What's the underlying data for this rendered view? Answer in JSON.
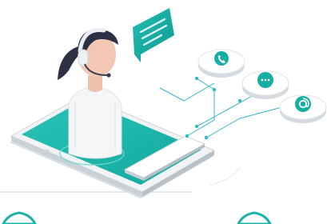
{
  "scene": {
    "channels": [
      {
        "name": "phone",
        "icon": "phone-icon"
      },
      {
        "name": "chat",
        "icon": "chat-bubble-icon"
      },
      {
        "name": "email",
        "icon": "at-sign-icon"
      }
    ],
    "colors": {
      "teal": "#1bb3a8",
      "teal_dark": "#0f8f87",
      "skin": "#f2c7b3",
      "hair": "#2d2f45",
      "shirt": "#f4f6f8",
      "headset": "#e9edf2",
      "line": "#35b8c7"
    }
  }
}
